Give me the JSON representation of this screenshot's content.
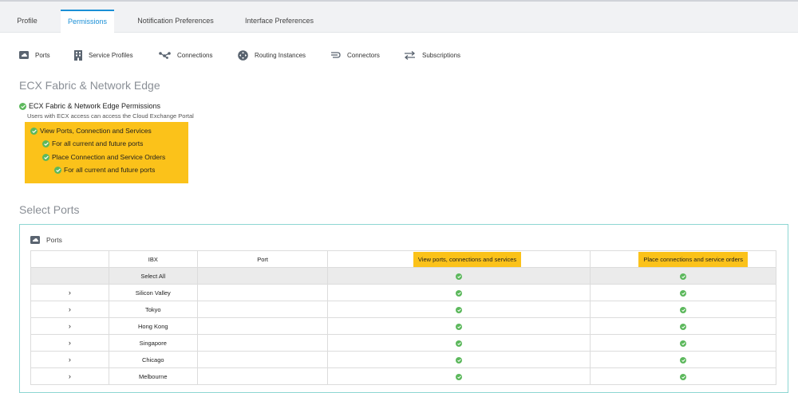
{
  "tabs": [
    {
      "label": "Profile",
      "active": false
    },
    {
      "label": "Permissions",
      "active": true
    },
    {
      "label": "Notification Preferences",
      "active": false
    },
    {
      "label": "Interface Preferences",
      "active": false
    }
  ],
  "subnav": [
    {
      "label": "Ports",
      "icon": "cloud-port-icon"
    },
    {
      "label": "Service Profiles",
      "icon": "building-icon"
    },
    {
      "label": "Connections",
      "icon": "network-nodes-icon"
    },
    {
      "label": "Routing Instances",
      "icon": "router-icon"
    },
    {
      "label": "Connectors",
      "icon": "connector-icon"
    },
    {
      "label": "Subscriptions",
      "icon": "swap-arrows-icon"
    }
  ],
  "ecx_section": {
    "title": "ECX Fabric & Network Edge",
    "root_permission": "ECX Fabric & Network Edge Permissions",
    "root_description": "Users with ECX access can access the Cloud Exchange Portal",
    "permissions": [
      {
        "label": "View Ports, Connection and Services",
        "level": 0
      },
      {
        "label": "For all current and future ports",
        "level": 1
      },
      {
        "label": "Place Connection and Service Orders",
        "level": 1
      },
      {
        "label": "For all current and future ports",
        "level": 2
      }
    ]
  },
  "select_ports": {
    "title": "Select Ports",
    "panel_title": "Ports",
    "columns": [
      "",
      "IBX",
      "Port",
      "View ports, connections and services",
      "Place connections and service orders"
    ],
    "select_all_label": "Select All",
    "rows": [
      {
        "ibx": "Silicon Valley"
      },
      {
        "ibx": "Tokyo"
      },
      {
        "ibx": "Hong Kong"
      },
      {
        "ibx": "Singapore"
      },
      {
        "ibx": "Chicago"
      },
      {
        "ibx": "Melbourne"
      }
    ]
  },
  "colors": {
    "accent": "#1a8fd6",
    "highlight": "#fbc21a",
    "check": "#5cb85c",
    "panel_border": "#8dd6d3"
  }
}
